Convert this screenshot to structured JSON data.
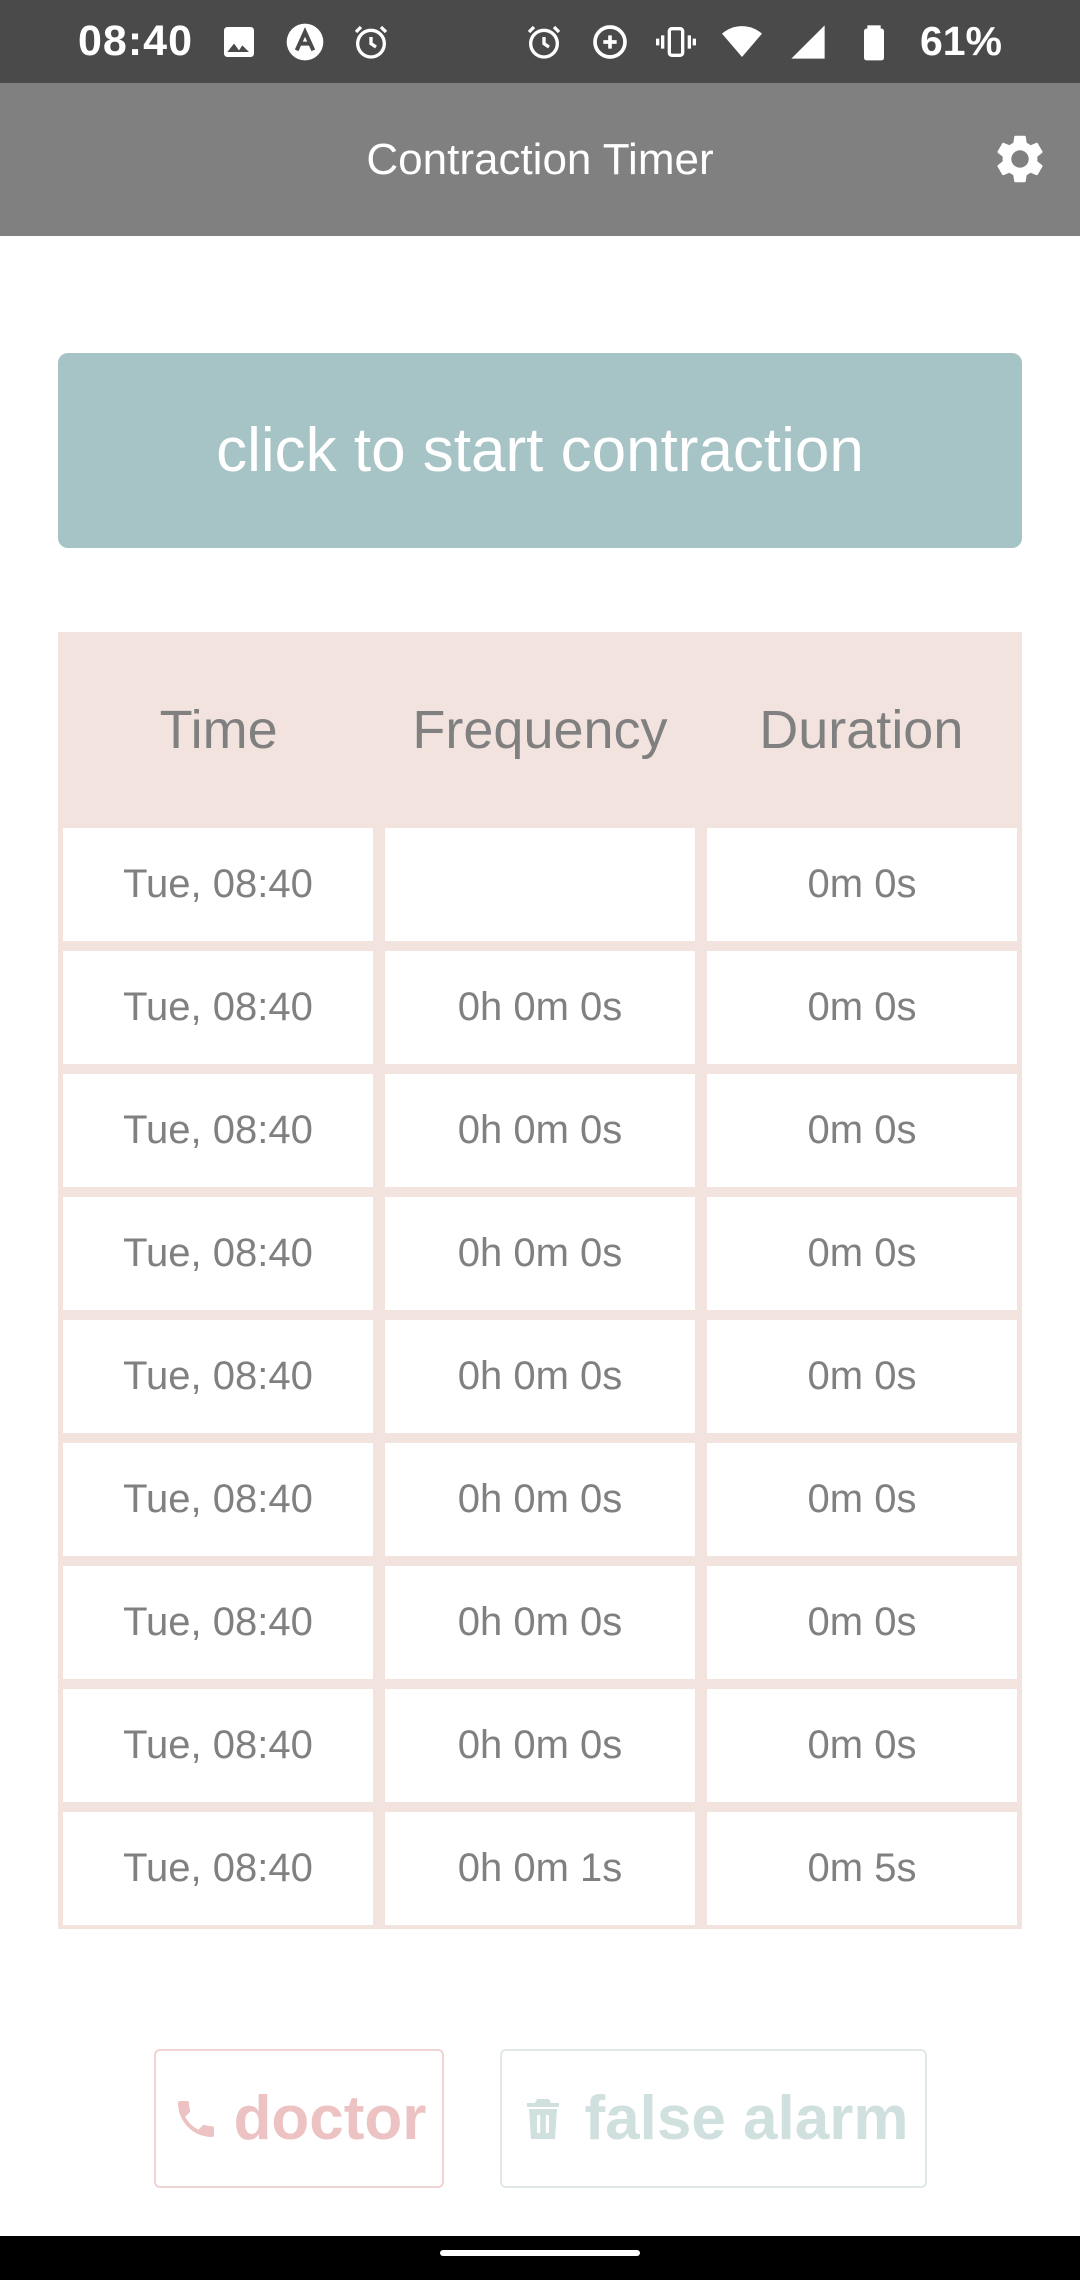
{
  "status_bar": {
    "time": "08:40",
    "battery": "61%",
    "icons_left": [
      "image-icon",
      "app-a-icon",
      "alarm-icon"
    ],
    "icons_right": [
      "alarm-icon",
      "data-saver-icon",
      "vibrate-icon",
      "wifi-icon",
      "signal-icon",
      "battery-icon"
    ]
  },
  "app_bar": {
    "title": "Contraction Timer",
    "settings_icon": "gear-icon"
  },
  "start_button": {
    "label": "click to start contraction",
    "color": "#a6c3c5"
  },
  "table": {
    "headers": [
      "Time",
      "Frequency",
      "Duration"
    ],
    "rows": [
      {
        "time": "Tue, 08:40",
        "frequency": "",
        "duration": "0m 0s"
      },
      {
        "time": "Tue, 08:40",
        "frequency": "0h 0m 0s",
        "duration": "0m 0s"
      },
      {
        "time": "Tue, 08:40",
        "frequency": "0h 0m 0s",
        "duration": "0m 0s"
      },
      {
        "time": "Tue, 08:40",
        "frequency": "0h 0m 0s",
        "duration": "0m 0s"
      },
      {
        "time": "Tue, 08:40",
        "frequency": "0h 0m 0s",
        "duration": "0m 0s"
      },
      {
        "time": "Tue, 08:40",
        "frequency": "0h 0m 0s",
        "duration": "0m 0s"
      },
      {
        "time": "Tue, 08:40",
        "frequency": "0h 0m 0s",
        "duration": "0m 0s"
      },
      {
        "time": "Tue, 08:40",
        "frequency": "0h 0m 0s",
        "duration": "0m 0s"
      },
      {
        "time": "Tue, 08:40",
        "frequency": "0h 0m 1s",
        "duration": "0m 5s"
      }
    ],
    "background_color": "#f2e3de"
  },
  "actions": {
    "doctor_label": "doctor",
    "doctor_icon": "phone-icon",
    "false_alarm_label": "false alarm",
    "false_alarm_icon": "trash-icon"
  },
  "colors": {
    "status_bar": "#4a4a4a",
    "app_bar": "#808080",
    "text_grey": "#808080",
    "doctor_pink": "#ecc2c2",
    "false_alarm_teal": "#cfe0de"
  }
}
